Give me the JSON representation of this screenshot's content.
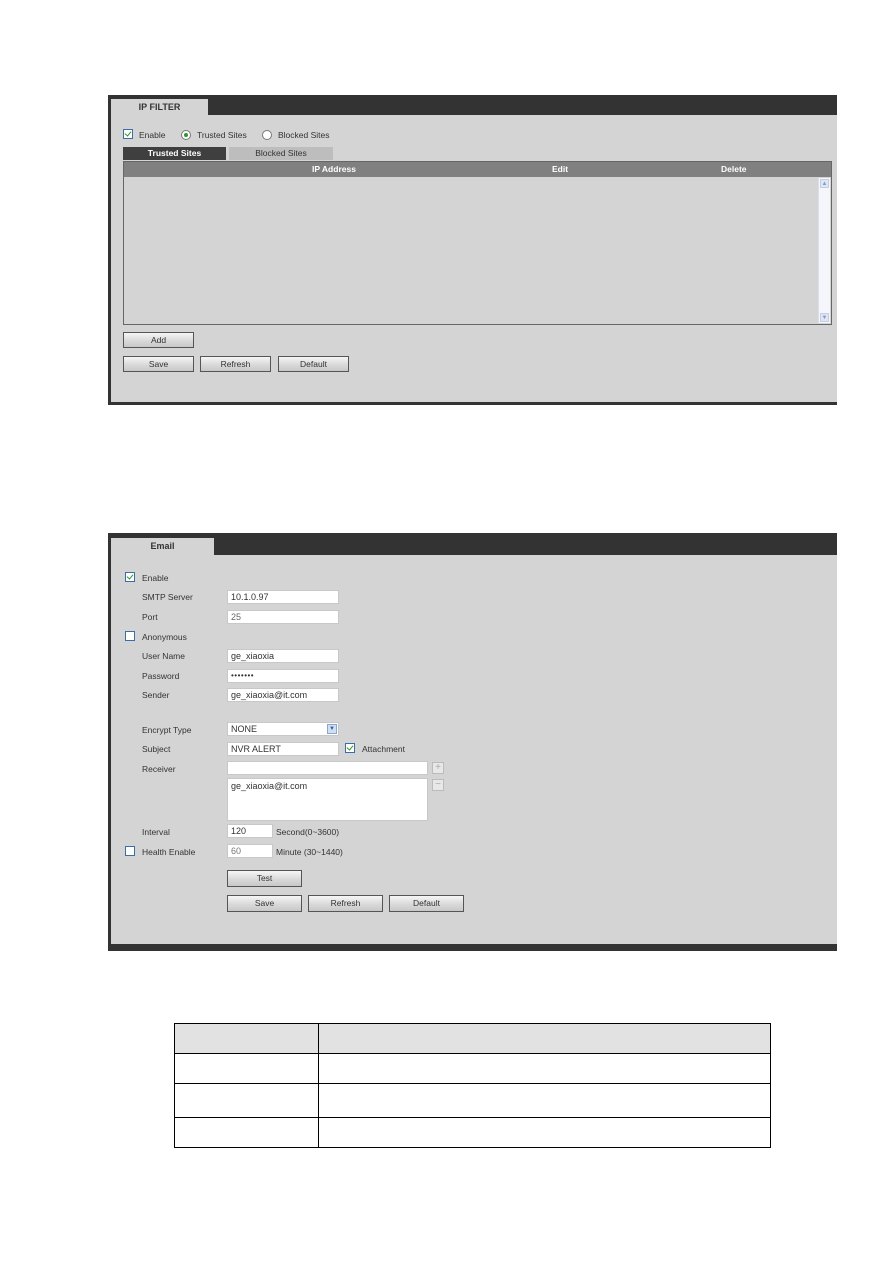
{
  "ip_filter": {
    "tab_title": "IP FILTER",
    "enable_label": "Enable",
    "enable_checked": true,
    "mode_options": [
      {
        "label": "Trusted Sites",
        "selected": true
      },
      {
        "label": "Blocked Sites",
        "selected": false
      }
    ],
    "sub_tabs": [
      {
        "label": "Trusted Sites",
        "active": true
      },
      {
        "label": "Blocked Sites",
        "active": false
      }
    ],
    "columns": [
      "IP Address",
      "Edit",
      "Delete"
    ],
    "rows": [],
    "buttons": {
      "add": "Add",
      "save": "Save",
      "refresh": "Refresh",
      "default": "Default"
    }
  },
  "email": {
    "tab_title": "Email",
    "enable_label": "Enable",
    "enable_checked": true,
    "smtp_server_label": "SMTP Server",
    "smtp_server_value": "10.1.0.97",
    "port_label": "Port",
    "port_value": "25",
    "anonymous_label": "Anonymous",
    "anonymous_checked": false,
    "user_name_label": "User Name",
    "user_name_value": "ge_xiaoxia",
    "password_label": "Password",
    "password_value": "•••••••",
    "sender_label": "Sender",
    "sender_value": "ge_xiaoxia@it.com",
    "encrypt_type_label": "Encrypt Type",
    "encrypt_type_value": "NONE",
    "subject_label": "Subject",
    "subject_value": "NVR ALERT",
    "attachment_label": "Attachment",
    "attachment_checked": true,
    "receiver_label": "Receiver",
    "receiver_input_value": "",
    "receiver_list": [
      "ge_xiaoxia@it.com"
    ],
    "add_receiver_symbol": "+",
    "remove_receiver_symbol": "−",
    "interval_label": "Interval",
    "interval_value": "120",
    "interval_unit": "Second(0~3600)",
    "health_enable_label": "Health Enable",
    "health_enable_checked": false,
    "health_value": "60",
    "health_unit": "Minute (30~1440)",
    "buttons": {
      "test": "Test",
      "save": "Save",
      "refresh": "Refresh",
      "default": "Default"
    }
  },
  "description_table": {
    "rows": [
      [
        "",
        ""
      ],
      [
        "",
        ""
      ],
      [
        "",
        ""
      ],
      [
        "",
        ""
      ]
    ]
  }
}
